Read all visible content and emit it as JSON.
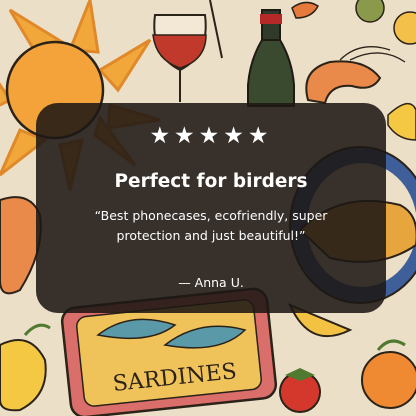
{
  "review": {
    "stars": "★★★★★",
    "rating": 5,
    "title": "Perfect for birders",
    "quote": "“Best phonecases, ecofriendly, super protection and just beautiful!”",
    "author": "— Anna U."
  },
  "illustration": {
    "tin_label": "SARDINES"
  }
}
